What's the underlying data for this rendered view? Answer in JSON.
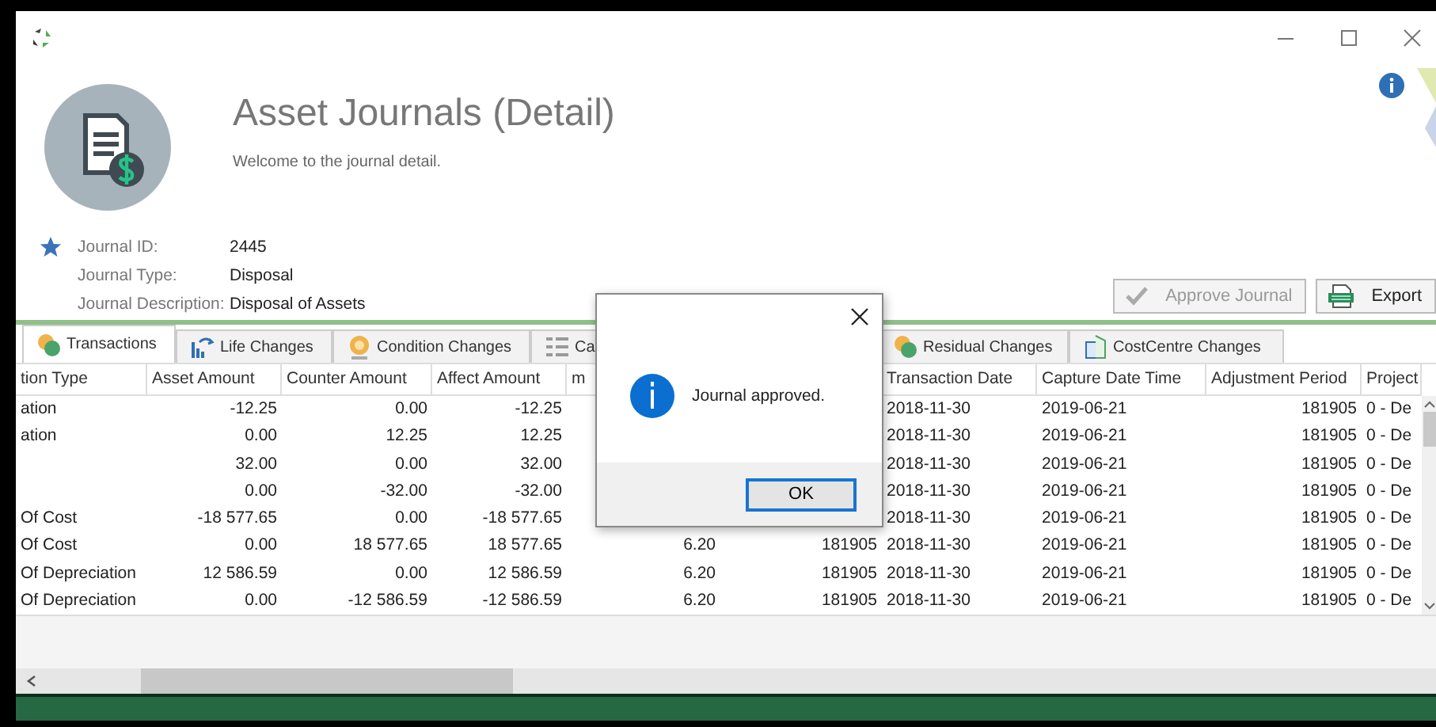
{
  "header": {
    "title": "Asset Journals (Detail)",
    "subtitle": "Welcome to the journal detail."
  },
  "fields": [
    {
      "label": "Journal ID:",
      "value": "2445",
      "starred": true
    },
    {
      "label": "Journal Type:",
      "value": "Disposal",
      "starred": false
    },
    {
      "label": "Journal Description:",
      "value": "Disposal of Assets",
      "starred": false
    }
  ],
  "buttons": [
    {
      "label": "Approve Journal",
      "disabled": true,
      "kind": "approve"
    },
    {
      "label": "Export",
      "disabled": false,
      "kind": "export"
    }
  ],
  "tabs": [
    {
      "label": "Transactions",
      "selected": true
    },
    {
      "label": "Life Changes",
      "selected": false
    },
    {
      "label": "Condition Changes",
      "selected": false
    },
    {
      "label": "Ca",
      "selected": false
    },
    {
      "label": "Residual Changes",
      "selected": false
    },
    {
      "label": "CostCentre Changes",
      "selected": false
    }
  ],
  "table": {
    "columns": [
      {
        "label": "tion Type"
      },
      {
        "label": "Asset Amount"
      },
      {
        "label": "Counter Amount"
      },
      {
        "label": "Affect Amount"
      },
      {
        "label": "m"
      },
      {},
      {
        "label": "Transaction Date"
      },
      {
        "label": "Capture Date Time"
      },
      {
        "label": "Adjustment Period"
      },
      {
        "label": "Project"
      }
    ],
    "rows": [
      [
        "ation",
        "-12.25",
        "0.00",
        "-12.25",
        null,
        null,
        "2018-11-30",
        "2019-06-21",
        "181905",
        "0 - De"
      ],
      [
        "ation",
        "0.00",
        "12.25",
        "12.25",
        null,
        null,
        "2018-11-30",
        "2019-06-21",
        "181905",
        "0 - De"
      ],
      [
        null,
        "32.00",
        "0.00",
        "32.00",
        null,
        null,
        "2018-11-30",
        "2019-06-21",
        "181905",
        "0 - De"
      ],
      [
        null,
        "0.00",
        "-32.00",
        "-32.00",
        null,
        null,
        "2018-11-30",
        "2019-06-21",
        "181905",
        "0 - De"
      ],
      [
        "Of Cost",
        "-18 577.65",
        "0.00",
        "-18 577.65",
        null,
        null,
        "2018-11-30",
        "2019-06-21",
        "181905",
        "0 - De"
      ],
      [
        "Of Cost",
        "0.00",
        "18 577.65",
        "18 577.65",
        "6.20",
        "181905",
        "2018-11-30",
        "2019-06-21",
        "181905",
        "0 - De"
      ],
      [
        "Of Depreciation",
        "12 586.59",
        "0.00",
        "12 586.59",
        "6.20",
        "181905",
        "2018-11-30",
        "2019-06-21",
        "181905",
        "0 - De"
      ],
      [
        "Of Depreciation",
        "0.00",
        "-12 586.59",
        "-12 586.59",
        "6.20",
        "181905",
        "2018-11-30",
        "2019-06-21",
        "181905",
        "0 - De"
      ]
    ]
  },
  "dialog": {
    "message": "Journal approved.",
    "button": "OK"
  }
}
